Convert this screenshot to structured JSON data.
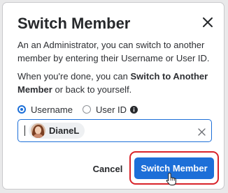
{
  "dialog": {
    "title": "Switch Member",
    "intro": "An an Administrator, you can switch to another member by entering their Username or User ID.",
    "done_prefix": "When you're done, you can ",
    "done_bold": "Switch to Another Member",
    "done_suffix": " or back to yourself."
  },
  "lookup": {
    "options": [
      {
        "label": "Username",
        "selected": true
      },
      {
        "label": "User ID",
        "selected": false,
        "info_icon": "info-icon"
      }
    ]
  },
  "member_input": {
    "chip_name": "DianeL",
    "avatar": "member-avatar",
    "clear_icon": "close-icon"
  },
  "actions": {
    "cancel_label": "Cancel",
    "switch_label": "Switch Member"
  },
  "colors": {
    "accent": "#1d6fd8",
    "highlight": "#d8232a",
    "text": "#26282b"
  }
}
